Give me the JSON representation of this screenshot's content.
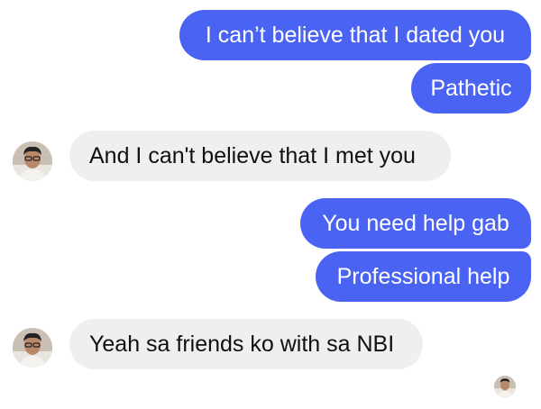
{
  "conversation": {
    "messages": [
      {
        "from": "me",
        "text": "I can’t believe that I dated you"
      },
      {
        "from": "me",
        "text": "Pathetic"
      },
      {
        "from": "them",
        "text": "And I can't believe that I met you"
      },
      {
        "from": "me",
        "text": "You need help gab"
      },
      {
        "from": "me",
        "text": "Professional help"
      },
      {
        "from": "them",
        "text": "Yeah sa friends ko with sa NBI"
      }
    ]
  },
  "icons": {
    "contact_avatar": "person-photo-icon",
    "read_receipt": "read-receipt-avatar-icon"
  },
  "colors": {
    "outgoing_bubble": "#4a63f2",
    "incoming_bubble": "#efefef",
    "outgoing_text": "#ffffff",
    "incoming_text": "#101010"
  }
}
